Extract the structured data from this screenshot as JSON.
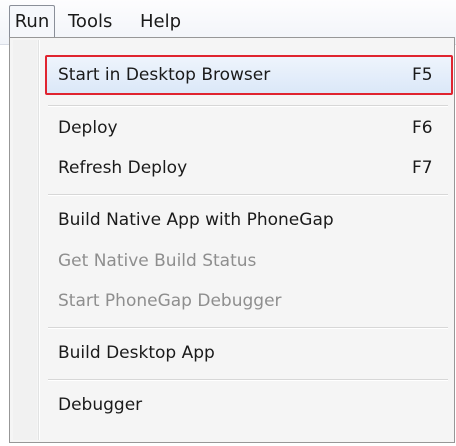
{
  "menubar": {
    "items": [
      {
        "label": "Run"
      },
      {
        "label": "Tools"
      },
      {
        "label": "Help"
      }
    ]
  },
  "run_menu": {
    "items": [
      {
        "label": "Start in Desktop Browser",
        "shortcut": "F5",
        "enabled": true,
        "highlighted": true
      },
      {
        "label": "Deploy",
        "shortcut": "F6",
        "enabled": true
      },
      {
        "label": "Refresh Deploy",
        "shortcut": "F7",
        "enabled": true
      },
      {
        "label": "Build Native App with PhoneGap",
        "shortcut": "",
        "enabled": true
      },
      {
        "label": "Get Native Build Status",
        "shortcut": "",
        "enabled": false
      },
      {
        "label": "Start PhoneGap Debugger",
        "shortcut": "",
        "enabled": false
      },
      {
        "label": "Build Desktop App",
        "shortcut": "",
        "enabled": true
      },
      {
        "label": "Debugger",
        "shortcut": "",
        "enabled": true
      }
    ]
  },
  "colors": {
    "highlight_border": "#e0242f",
    "disabled_text": "#8e8e8e"
  }
}
